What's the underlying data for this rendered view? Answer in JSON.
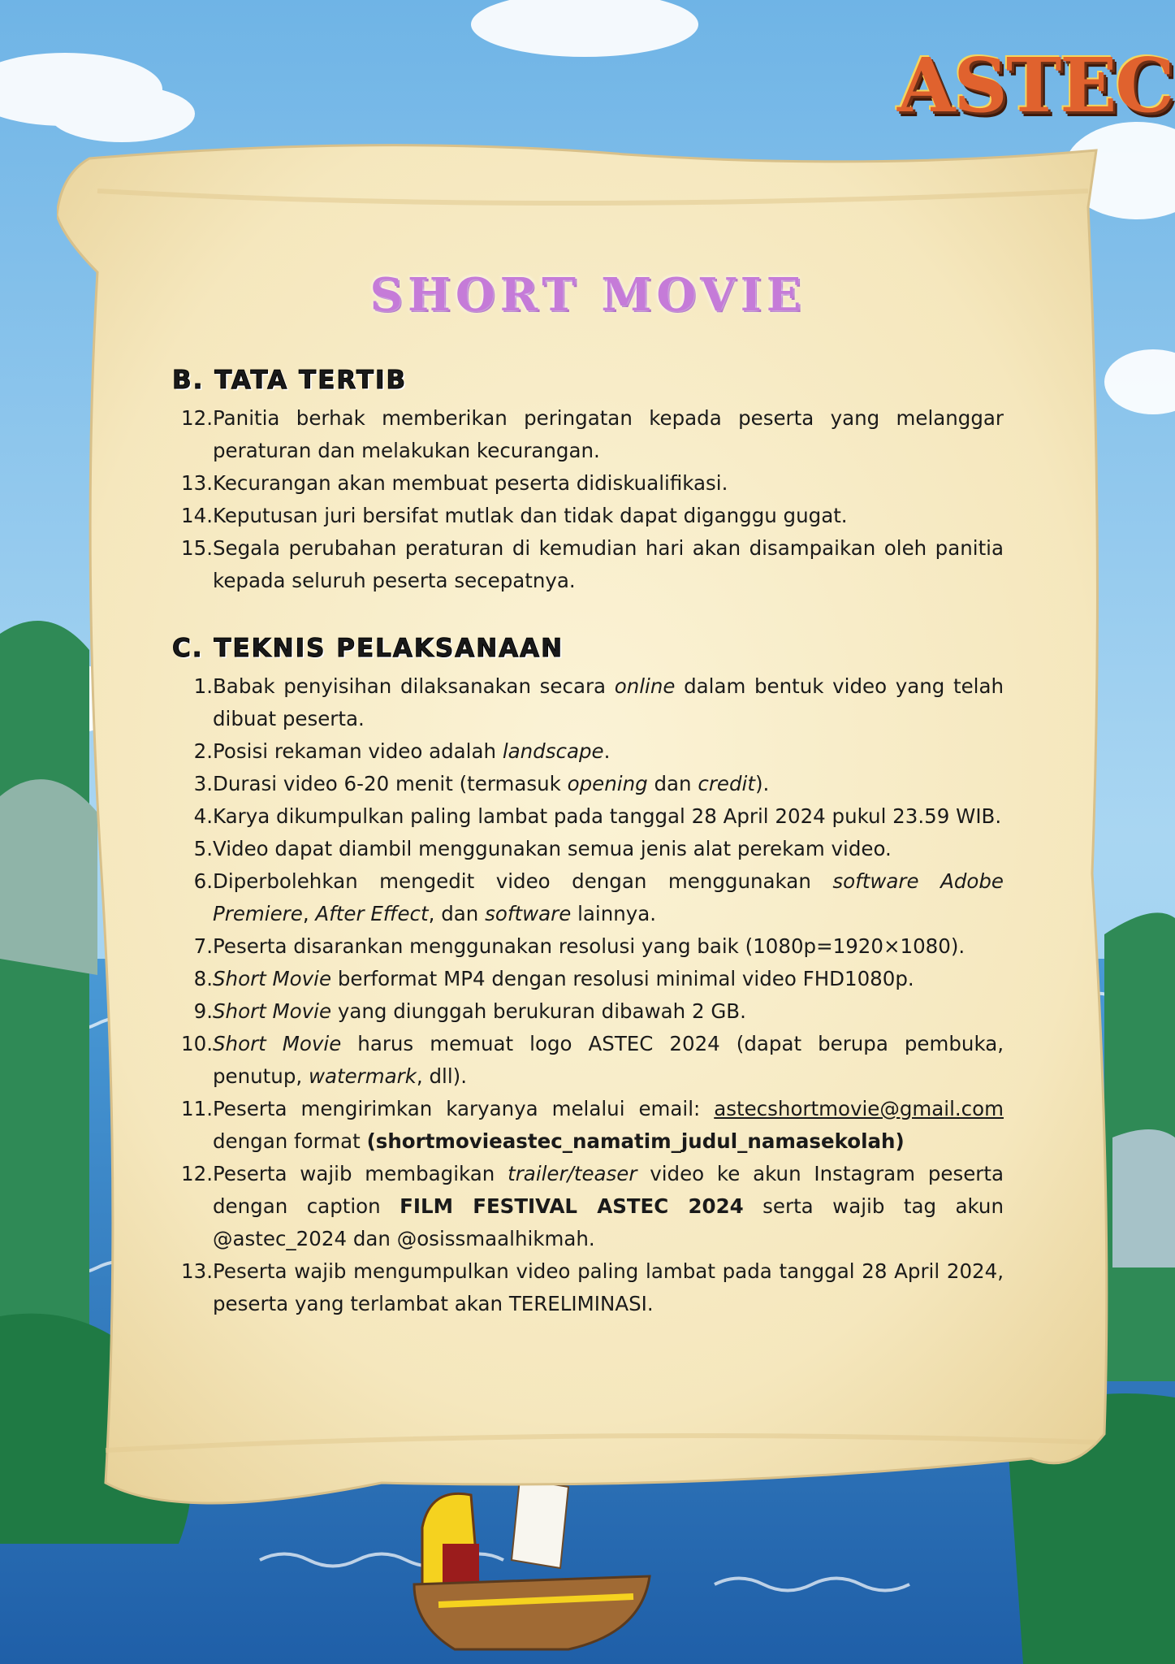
{
  "logo": {
    "text": "ASTEC"
  },
  "title": "SHORT MOVIE",
  "section_b": {
    "heading": "B. TATA TERTIB",
    "items": [
      {
        "num": "12.",
        "text": "Panitia berhak memberikan peringatan kepada peserta yang melanggar peraturan dan melakukan kecurangan."
      },
      {
        "num": "13.",
        "text": "Kecurangan akan membuat peserta didiskualifikasi."
      },
      {
        "num": "14.",
        "text": "Keputusan juri bersifat mutlak dan tidak dapat diganggu gugat."
      },
      {
        "num": "15.",
        "text": "Segala perubahan peraturan di kemudian hari akan disampaikan oleh panitia kepada seluruh peserta secepatnya."
      }
    ]
  },
  "section_c": {
    "heading": "C. TEKNIS PELAKSANAAN",
    "items": [
      {
        "num": "1.",
        "parts": [
          "Babak penyisihan dilaksanakan secara ",
          "online",
          " dalam bentuk video yang telah dibuat peserta."
        ]
      },
      {
        "num": "2.",
        "parts": [
          "Posisi rekaman video adalah ",
          "landscape",
          "."
        ]
      },
      {
        "num": "3.",
        "parts": [
          "Durasi video 6-20 menit (termasuk ",
          "opening",
          " dan ",
          "credit",
          ")."
        ]
      },
      {
        "num": "4.",
        "parts": [
          "Karya dikumpulkan paling lambat pada tanggal 28 April 2024 pukul 23.59 WIB."
        ]
      },
      {
        "num": "5.",
        "parts": [
          "Video dapat diambil menggunakan semua jenis alat perekam video."
        ]
      },
      {
        "num": "6.",
        "parts": [
          "Diperbolehkan mengedit video dengan menggunakan ",
          "software Adobe Premiere",
          ", ",
          "After Effect",
          ", dan ",
          "software",
          " lainnya."
        ]
      },
      {
        "num": "7.",
        "parts": [
          "Peserta disarankan menggunakan resolusi yang baik (1080p=1920×1080)."
        ]
      },
      {
        "num": "8.",
        "parts": [
          "Short Movie",
          " berformat MP4 dengan resolusi minimal video FHD1080p."
        ]
      },
      {
        "num": "9.",
        "parts": [
          "Short Movie",
          " yang diunggah berukuran dibawah 2 GB."
        ]
      },
      {
        "num": "10.",
        "parts": [
          "Short Movie",
          " harus memuat logo ASTEC 2024 (dapat berupa pembuka, penutup, ",
          "watermark",
          ", dll)."
        ]
      },
      {
        "num": "11.",
        "parts": [
          "Peserta mengirimkan karyanya melalui email: ",
          "astecshortmovie@gmail.com",
          " dengan format ",
          "(shortmovieastec_namatim_judul_namasekolah)"
        ]
      },
      {
        "num": "12.",
        "parts": [
          "Peserta wajib membagikan ",
          "trailer/teaser",
          " video ke akun Instagram peserta dengan caption ",
          "FILM FESTIVAL ASTEC 2024",
          " serta wajib tag akun @astec_2024 dan @osissmaalhikmah."
        ]
      },
      {
        "num": "13.",
        "parts": [
          "Peserta wajib mengumpulkan video paling lambat pada tanggal 28 April 2024, peserta yang terlambat akan TERELIMINASI."
        ]
      }
    ]
  },
  "colors": {
    "sky": "#8ec8ee",
    "sea": "#2f7fc4",
    "parchment": "#f7ecc6",
    "title": "#c57bd8"
  }
}
